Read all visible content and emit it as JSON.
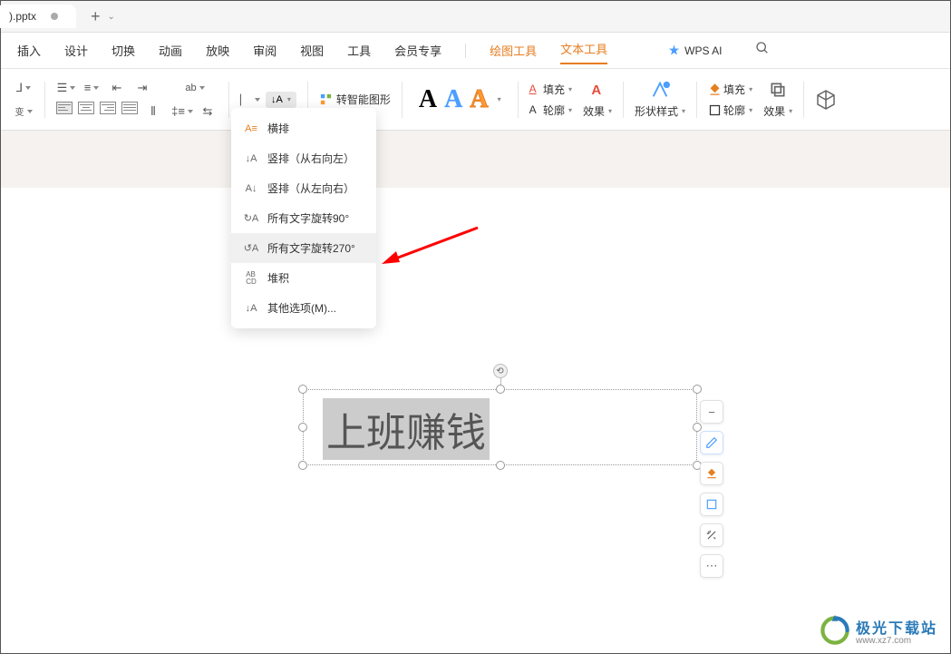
{
  "tab": {
    "title": ").pptx"
  },
  "menu": {
    "items": [
      "插入",
      "设计",
      "切换",
      "动画",
      "放映",
      "审阅",
      "视图",
      "工具",
      "会员专享"
    ],
    "drawing_tools": "绘图工具",
    "text_tools": "文本工具",
    "wps_ai": "WPS AI"
  },
  "ribbon": {
    "smart_graphic": "转智能图形",
    "fill": "填充",
    "outline": "轮廓",
    "effect": "效果",
    "shape_style": "形状样式",
    "fill2": "填充",
    "outline2": "轮廓",
    "effect2": "效果",
    "wordart_A": "A"
  },
  "dropdown": {
    "horizontal": "横排",
    "vertical_rtl": "竖排（从右向左）",
    "vertical_ltr": "竖排（从左向右）",
    "rotate_90": "所有文字旋转90°",
    "rotate_270": "所有文字旋转270°",
    "stacked": "堆积",
    "more_options": "其他选项(M)..."
  },
  "textbox": {
    "text": "上班赚钱"
  },
  "watermark": {
    "title": "极光下载站",
    "url": "www.xz7.com"
  }
}
